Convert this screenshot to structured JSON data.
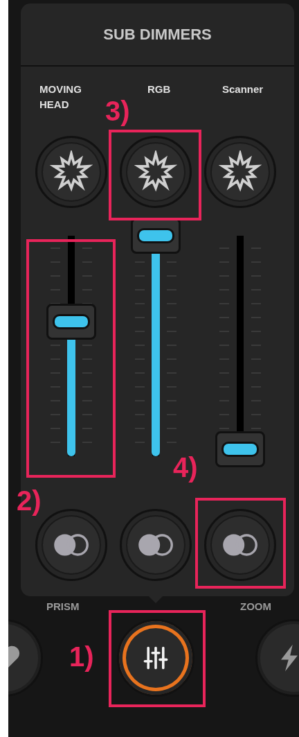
{
  "panel": {
    "title": "SUB DIMMERS"
  },
  "channels": [
    {
      "label": "MOVING HEAD",
      "level": 0.61
    },
    {
      "label": "RGB",
      "level": 1
    },
    {
      "label": "Scanner",
      "level": 0.03
    }
  ],
  "toggle_labels": {
    "left": "PRISM",
    "right": "ZOOM"
  },
  "dock": [
    {
      "kind": "heart",
      "selected": false
    },
    {
      "kind": "mixer",
      "selected": true
    },
    {
      "kind": "bolt",
      "selected": false
    }
  ],
  "annotations": [
    {
      "label": "1)"
    },
    {
      "label": "2)"
    },
    {
      "label": "3)"
    },
    {
      "label": "4)"
    }
  ]
}
